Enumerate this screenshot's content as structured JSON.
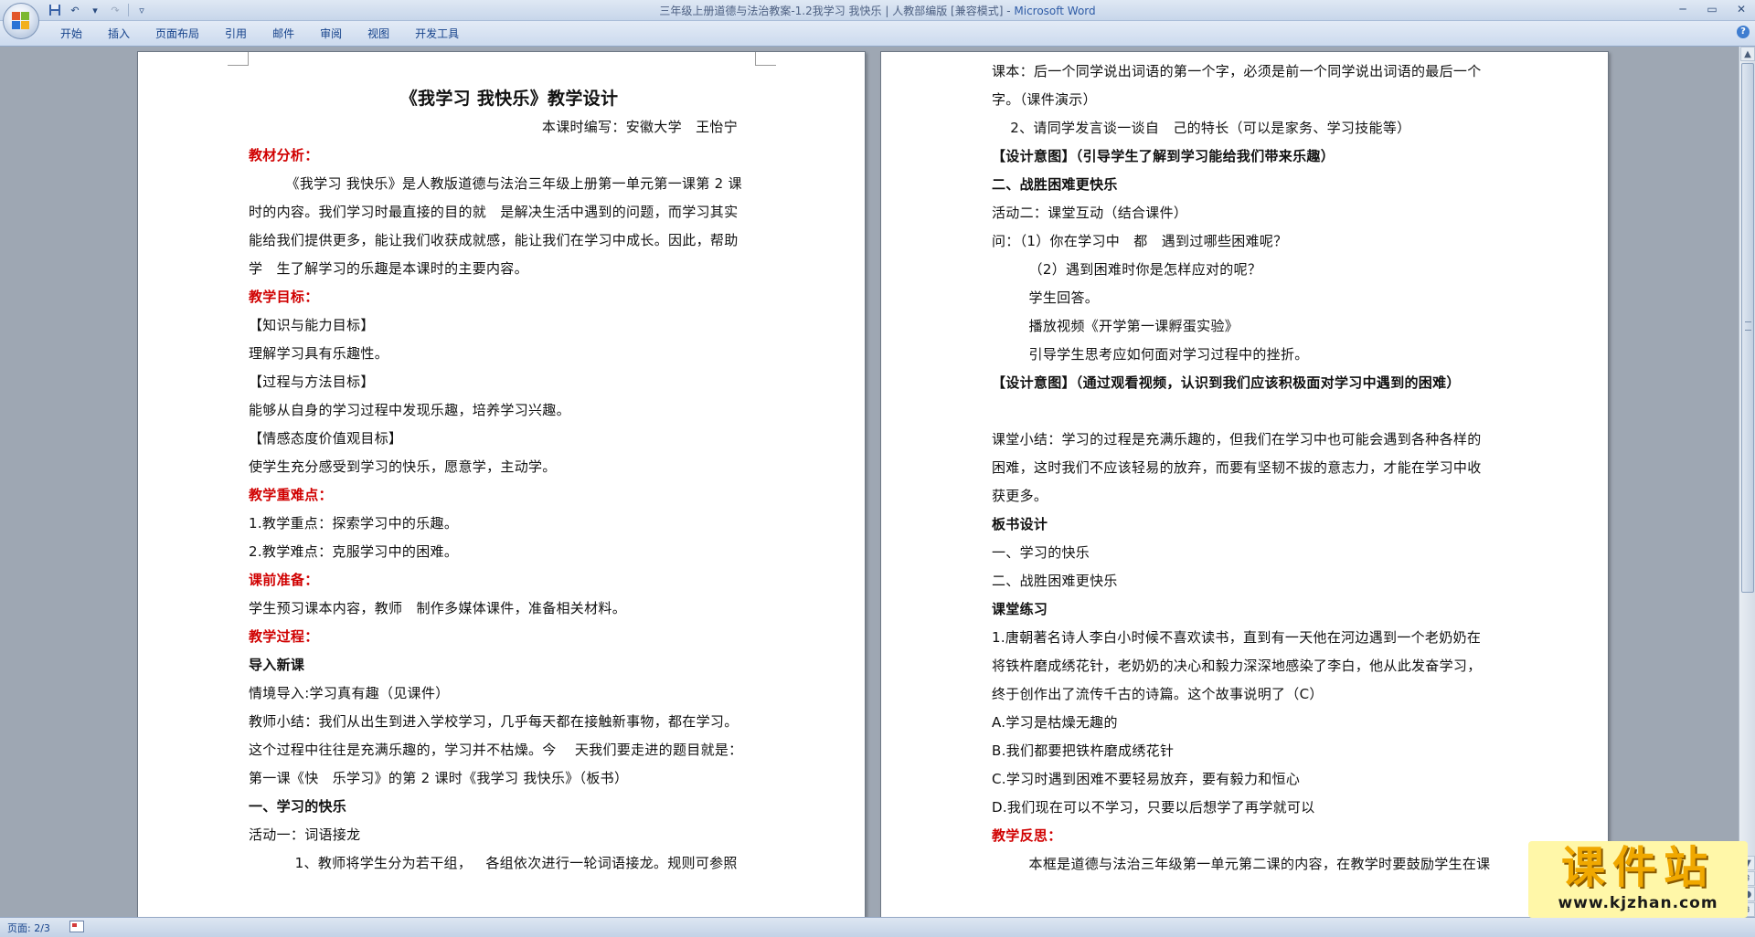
{
  "window": {
    "title_doc": "三年级上册道德与法治教案-1.2我学习 我快乐 | 人教部编版 [兼容模式] - ",
    "title_app": "Microsoft Word"
  },
  "ribbon": {
    "tabs": [
      "开始",
      "插入",
      "页面布局",
      "引用",
      "邮件",
      "审阅",
      "视图",
      "开发工具"
    ]
  },
  "left_page": {
    "lines": [
      {
        "text": "",
        "style": ""
      },
      {
        "text": "《我学习 我快乐》教学设计",
        "style": "title"
      },
      {
        "text": "本课时编写：安徽大学   王怡宁",
        "style": "right"
      },
      {
        "text": "教材分析：",
        "style": "red"
      },
      {
        "text": "        《我学习 我快乐》是人教版道德与法治三年级上册第一单元第一课第 2 课",
        "style": ""
      },
      {
        "text": "时的内容。我们学习时最直接的目的就   是解决生活中遇到的问题，而学习其实",
        "style": ""
      },
      {
        "text": "能给我们提供更多，能让我们收获成就感，能让我们在学习中成长。因此，帮助",
        "style": ""
      },
      {
        "text": "学   生了解学习的乐趣是本课时的主要内容。",
        "style": ""
      },
      {
        "text": "教学目标：",
        "style": "red"
      },
      {
        "text": "【知识与能力目标】",
        "style": ""
      },
      {
        "text": "理解学习具有乐趣性。",
        "style": ""
      },
      {
        "text": "【过程与方法目标】",
        "style": ""
      },
      {
        "text": "能够从自身的学习过程中发现乐趣，培养学习兴趣。",
        "style": ""
      },
      {
        "text": "【情感态度价值观目标】   ",
        "style": ""
      },
      {
        "text": "使学生充分感受到学习的快乐，愿意学，主动学。",
        "style": ""
      },
      {
        "text": "教学重难点：",
        "style": "red"
      },
      {
        "text": "1.教学重点：探索学习中的乐趣。",
        "style": ""
      },
      {
        "text": "2.教学难点：克服学习中的困难。",
        "style": ""
      },
      {
        "text": "课前准备：",
        "style": "red"
      },
      {
        "text": "学生预习课本内容，教师   制作多媒体课件，准备相关材料。",
        "style": ""
      },
      {
        "text": "教学过程：",
        "style": "red"
      },
      {
        "text": "导入新课",
        "style": "bold"
      },
      {
        "text": "情境导入:学习真有趣（见课件）",
        "style": ""
      },
      {
        "text": "教师小结：我们从出生到进入学校学习，几乎每天都在接触新事物，都在学习。",
        "style": ""
      },
      {
        "text": "这个过程中往往是充满乐趣的，学习并不枯燥。今    天我们要走进的题目就是：",
        "style": ""
      },
      {
        "text": "第一课《快   乐学习》的第 2 课时《我学习 我快乐》（板书）",
        "style": ""
      },
      {
        "text": "一、学习的快乐",
        "style": "bold"
      },
      {
        "text": "活动一：词语接龙",
        "style": ""
      },
      {
        "text": "          1、教师将学生分为若干组，   各组依次进行一轮词语接龙。规则可参照",
        "style": ""
      }
    ]
  },
  "right_page": {
    "lines": [
      {
        "text": "课本：后一个同学说出词语的第一个字，必须是前一个同学说出词语的最后一个",
        "style": ""
      },
      {
        "text": "字。（课件演示）",
        "style": ""
      },
      {
        "text": "    2、请同学发言谈一谈自   己的特长（可以是家务、学习技能等）",
        "style": ""
      },
      {
        "text": "【设计意图】（引导学生了解到学习能给我们带来乐趣）",
        "style": "bold"
      },
      {
        "text": "二、战胜困难更快乐",
        "style": "bold"
      },
      {
        "text": "活动二：课堂互动（结合课件）",
        "style": ""
      },
      {
        "text": "问：（1）你在学习中   都   遇到过哪些困难呢？ ",
        "style": ""
      },
      {
        "text": "        （2）遇到困难时你是怎样应对的呢？",
        "style": ""
      },
      {
        "text": "        学生回答。",
        "style": ""
      },
      {
        "text": "        播放视频《开学第一课孵蛋实验》",
        "style": ""
      },
      {
        "text": "        引导学生思考应如何面对学习过程中的挫折。",
        "style": ""
      },
      {
        "text": "【设计意图】（通过观看视频，认识到我们应该积极面对学习中遇到的困难）",
        "style": "bold"
      },
      {
        "text": "    ",
        "style": ""
      },
      {
        "text": "课堂小结：学习的过程是充满乐趣的，但我们在学习中也可能会遇到各种各样的",
        "style": ""
      },
      {
        "text": "困难，这时我们不应该轻易的放弃，而要有坚韧不拔的意志力，才能在学习中收",
        "style": ""
      },
      {
        "text": "获更多。",
        "style": ""
      },
      {
        "text": "板书设计   ",
        "style": "bold"
      },
      {
        "text": "一、学习的快乐   ",
        "style": ""
      },
      {
        "text": "二、战胜困难更快乐",
        "style": ""
      },
      {
        "text": "课堂练习  ",
        "style": "bold"
      },
      {
        "text": "1.唐朝著名诗人李白小时候不喜欢读书，直到有一天他在河边遇到一个老奶奶在",
        "style": ""
      },
      {
        "text": "将铁杵磨成绣花针，老奶奶的决心和毅力深深地感染了李白，他从此发奋学习，",
        "style": ""
      },
      {
        "text": "终于创作出了流传千古的诗篇。这个故事说明了（C）",
        "style": ""
      },
      {
        "text": "A.学习是枯燥无趣的",
        "style": ""
      },
      {
        "text": "B.我们都要把铁杵磨成绣花针",
        "style": ""
      },
      {
        "text": "C.学习时遇到困难不要轻易放弃，要有毅力和恒心",
        "style": ""
      },
      {
        "text": "D.我们现在可以不学习，只要以后想学了再学就可以   ",
        "style": ""
      },
      {
        "text": "教学反思：",
        "style": "red"
      },
      {
        "text": "        本框是道德与法治三年级第一单元第二课的内容，在教学时要鼓励学生在课",
        "style": ""
      }
    ]
  },
  "statusbar": {
    "page_indicator": "页面: 2/3"
  },
  "watermark": {
    "title": "课件站",
    "url": "www.kjzhan.com"
  }
}
